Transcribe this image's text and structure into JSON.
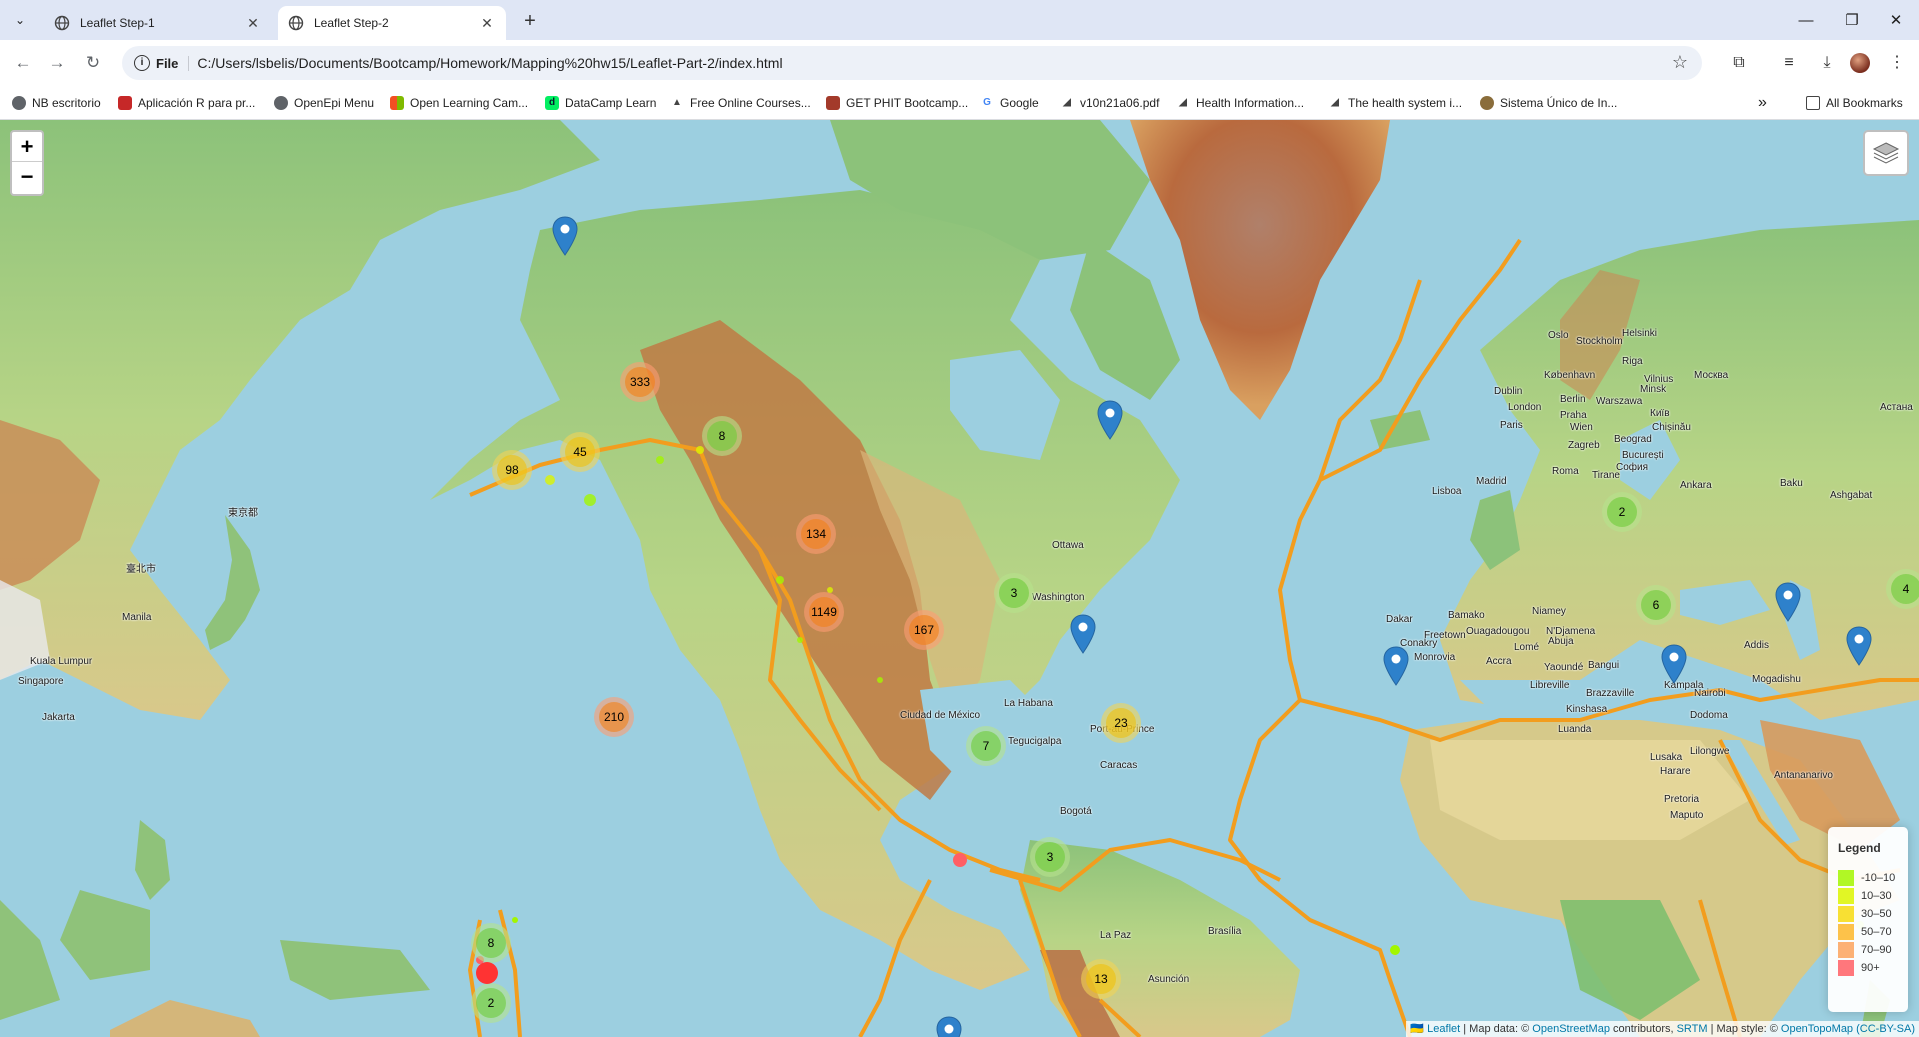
{
  "browser": {
    "tabs": [
      {
        "title": "Leaflet Step-1",
        "active": false
      },
      {
        "title": "Leaflet Step-2",
        "active": true
      }
    ],
    "new_tab_label": "+",
    "window_controls": {
      "minimize": "—",
      "restore": "❐",
      "close": "✕"
    },
    "address": {
      "scheme_chip": "File",
      "url": "C:/Users/lsbelis/Documents/Bootcamp/Homework/Mapping%20hw15/Leaflet-Part-2/index.html"
    },
    "bookmarks": [
      {
        "label": "NB escritorio",
        "icon": "globe-icon",
        "color": "#5f6368"
      },
      {
        "label": "Aplicación R para pr...",
        "icon": "red-app-icon",
        "color": "#c62828"
      },
      {
        "label": "OpenEpi Menu",
        "icon": "globe-icon",
        "color": "#5f6368"
      },
      {
        "label": "Open Learning Cam...",
        "icon": "windows-icon",
        "color": "#0078d4"
      },
      {
        "label": "DataCamp Learn",
        "icon": "datacamp-icon",
        "color": "#03ef62"
      },
      {
        "label": "Free Online Courses...",
        "icon": "mountain-icon",
        "color": "#444444"
      },
      {
        "label": "GET PHIT Bootcamp...",
        "icon": "grid-icon",
        "color": "#a33a2a"
      },
      {
        "label": "Google",
        "icon": "google-icon",
        "color": "#4285f4"
      },
      {
        "label": "v10n21a06.pdf",
        "icon": "pdf-icon",
        "color": "#444444"
      },
      {
        "label": "Health Information...",
        "icon": "pdf-icon",
        "color": "#444444"
      },
      {
        "label": "The health system i...",
        "icon": "pdf-icon",
        "color": "#444444"
      },
      {
        "label": "Sistema Único de In...",
        "icon": "seal-icon",
        "color": "#8a6d3b"
      }
    ],
    "overflow_label": "»",
    "all_bookmarks_label": "All Bookmarks"
  },
  "map": {
    "zoom_in": "+",
    "zoom_out": "−",
    "clusters": [
      {
        "count": "333",
        "tone": "orange"
      },
      {
        "count": "8",
        "tone": "green"
      },
      {
        "count": "45",
        "tone": "yellow"
      },
      {
        "count": "98",
        "tone": "yellow"
      },
      {
        "count": "134",
        "tone": "orange"
      },
      {
        "count": "1149",
        "tone": "orange"
      },
      {
        "count": "167",
        "tone": "orange"
      },
      {
        "count": "3",
        "tone": "green"
      },
      {
        "count": "210",
        "tone": "orange"
      },
      {
        "count": "23",
        "tone": "yellow"
      },
      {
        "count": "7",
        "tone": "green"
      },
      {
        "count": "3",
        "tone": "green"
      },
      {
        "count": "13",
        "tone": "yellow"
      },
      {
        "count": "8",
        "tone": "green"
      },
      {
        "count": "2",
        "tone": "green"
      },
      {
        "count": "2",
        "tone": "green"
      },
      {
        "count": "6",
        "tone": "green"
      },
      {
        "count": "4",
        "tone": "green"
      }
    ],
    "cities": [
      "Ottawa",
      "Washington",
      "La Habana",
      "Port-au-Prince",
      "Tegucigalpa",
      "Caracas",
      "Bogotá",
      "La Paz",
      "Brasília",
      "Asunción",
      "Ciudad de México",
      "Oslo",
      "Stockholm",
      "Helsinki",
      "Riga",
      "Vilnius",
      "Москва",
      "København",
      "Dublin",
      "London",
      "Berlin",
      "Warszawa",
      "Minsk",
      "Paris",
      "Praha",
      "Wien",
      "Київ",
      "Chișinău",
      "Zagreb",
      "Beograd",
      "București",
      "Roma",
      "Tirane",
      "София",
      "Lisboa",
      "Madrid",
      "Ankara",
      "Baku",
      "Ashgabat",
      "Dakar",
      "Bamako",
      "Niamey",
      "Ouagadougou",
      "N'Djamena",
      "Conakry",
      "Freetown",
      "Monrovia",
      "Accra",
      "Lomé",
      "Abuja",
      "Yaoundé",
      "Bangui",
      "Libreville",
      "Brazzaville",
      "Kinshasa",
      "Luanda",
      "Kampala",
      "Nairobi",
      "Dodoma",
      "Addis",
      "Mogadishu",
      "Lusaka",
      "Harare",
      "Lilongwe",
      "Pretoria",
      "Maputo",
      "Antananarivo",
      "Manila",
      "Kuala Lumpur",
      "Singapore",
      "Jakarta",
      "東京都",
      "臺北市",
      "Астана"
    ],
    "legend": {
      "title": "Legend",
      "items": [
        {
          "label": "-10–10",
          "color": "#a3f600"
        },
        {
          "label": "10–30",
          "color": "#dcf400"
        },
        {
          "label": "30–50",
          "color": "#f7db11"
        },
        {
          "label": "50–70",
          "color": "#fdb72a"
        },
        {
          "label": "70–90",
          "color": "#fca35d"
        },
        {
          "label": "90+",
          "color": "#ff5f65"
        }
      ]
    },
    "attribution": {
      "flag": "🇺🇦",
      "leaflet": "Leaflet",
      "sep1": " | Map data: © ",
      "osm": "OpenStreetMap",
      "contrib": " contributors, ",
      "srtm": "SRTM",
      "style": " | Map style: © ",
      "otm": "OpenTopoMap (CC-BY-SA)"
    },
    "colors": {
      "ocean": "#9ccfe0",
      "plate_boundary": "#f29d1e",
      "cluster_green": "#b5e28c",
      "cluster_yellow": "#f1d357",
      "cluster_orange": "#fd9c73",
      "marker_blue": "#2e81cb"
    }
  }
}
